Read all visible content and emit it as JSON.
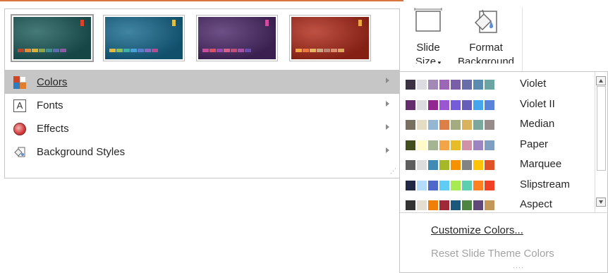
{
  "ribbon": {
    "slide_size": {
      "line1": "Slide",
      "line2": "Size"
    },
    "format_background": {
      "line1": "Format",
      "line2": "Background"
    }
  },
  "themes": [
    {
      "name": "theme-teal",
      "bg": "#1d5d5c",
      "tag": "#d9442c",
      "strip": [
        "#b5452f",
        "#e58a30",
        "#d7b035",
        "#8ca34b",
        "#3e8f8c",
        "#5a6cae",
        "#8a5aa5"
      ]
    },
    {
      "name": "theme-blue",
      "bg": "#176a8f",
      "tag": "#dbc04a",
      "strip": [
        "#e6b93c",
        "#8cc054",
        "#3fb1a4",
        "#44a2d8",
        "#5b7bcf",
        "#8b68bf",
        "#b04d93"
      ]
    },
    {
      "name": "theme-purple",
      "bg": "#4d2a6b",
      "tag": "#d14ca0",
      "strip": [
        "#cb4a9a",
        "#dd4f62",
        "#9b49b0",
        "#d45f8a",
        "#c44c79",
        "#a94fa6",
        "#6a4baf"
      ]
    },
    {
      "name": "theme-red",
      "bg": "#b02b1b",
      "tag": "#f0a640",
      "strip": [
        "#f2a541",
        "#e9783a",
        "#e5b65b",
        "#c9a77f",
        "#ba8570",
        "#d88f6d",
        "#e0a35e"
      ]
    }
  ],
  "menu": {
    "items": [
      {
        "key": "colors",
        "label": "Colors",
        "accel": "C"
      },
      {
        "key": "fonts",
        "label": "Fonts",
        "accel": "F"
      },
      {
        "key": "effects",
        "label": "Effects",
        "accel": "E"
      },
      {
        "key": "background",
        "label": "Background Styles",
        "accel": "B"
      }
    ]
  },
  "palettes": [
    {
      "name": "Violet",
      "chips": [
        "#3a3144",
        "#dcdce0",
        "#a38ab6",
        "#9b67b6",
        "#7b5ea8",
        "#6a6ea8",
        "#5a8cb0",
        "#6aa5a3"
      ]
    },
    {
      "name": "Violet II",
      "chips": [
        "#632c6a",
        "#dcdce0",
        "#92278f",
        "#9b57d3",
        "#755dd9",
        "#665eb8",
        "#45a5ed",
        "#5982db"
      ]
    },
    {
      "name": "Median",
      "chips": [
        "#786f61",
        "#e5ddc3",
        "#94b6d2",
        "#dd8047",
        "#a5ab81",
        "#d8b25c",
        "#7ba79d",
        "#968c8c"
      ]
    },
    {
      "name": "Paper",
      "chips": [
        "#424e1e",
        "#fefac9",
        "#a5b592",
        "#f3a447",
        "#e7bc29",
        "#d092a7",
        "#9c85c0",
        "#809ec2"
      ]
    },
    {
      "name": "Marquee",
      "chips": [
        "#5e5e5e",
        "#dddddd",
        "#418ab3",
        "#a6b727",
        "#f69200",
        "#838383",
        "#fec306",
        "#df5327"
      ]
    },
    {
      "name": "Slipstream",
      "chips": [
        "#212745",
        "#b4dcfa",
        "#4e67c8",
        "#5eccf3",
        "#a7ea52",
        "#5dceaf",
        "#ff8021",
        "#f14124"
      ]
    },
    {
      "name": "Aspect",
      "chips": [
        "#323232",
        "#e3ded1",
        "#f07f09",
        "#9f2936",
        "#1b587c",
        "#4e8542",
        "#604878",
        "#c19859"
      ]
    }
  ],
  "submenu": {
    "customize": {
      "label": "Customize Colors...",
      "accel": "C"
    },
    "reset": {
      "label": "Reset Slide Theme Colors",
      "accel": "R"
    }
  }
}
